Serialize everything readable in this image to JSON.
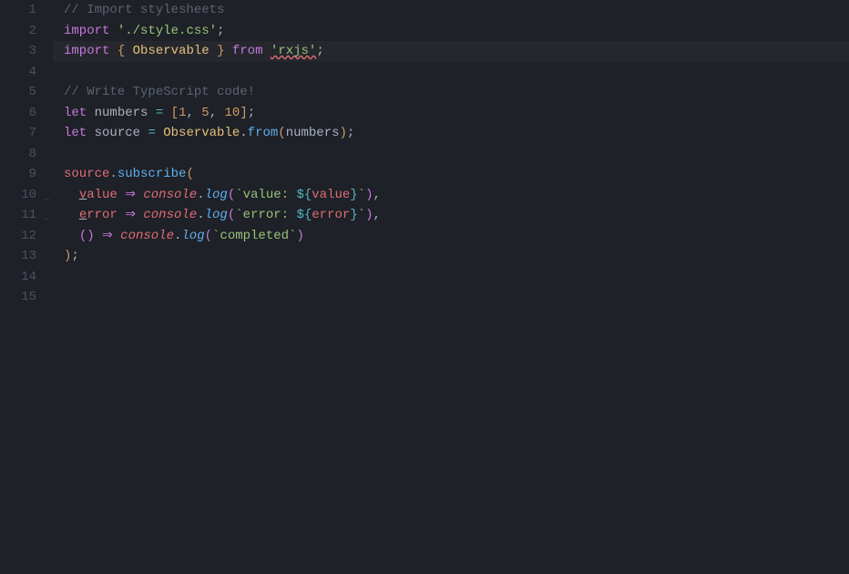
{
  "editor": {
    "language": "typescript",
    "currentLine": 3,
    "lineNumbers": [
      "1",
      "2",
      "3",
      "4",
      "5",
      "6",
      "7",
      "8",
      "9",
      "10",
      "11",
      "12",
      "13",
      "14",
      "15"
    ],
    "lines": [
      {
        "tokens": [
          {
            "t": "// Import stylesheets",
            "c": "cm"
          }
        ]
      },
      {
        "tokens": [
          {
            "t": "import",
            "c": "kw"
          },
          {
            "t": " ",
            "c": "pun"
          },
          {
            "t": "'./style.css'",
            "c": "str"
          },
          {
            "t": ";",
            "c": "pun"
          }
        ]
      },
      {
        "tokens": [
          {
            "t": "import",
            "c": "kw"
          },
          {
            "t": " ",
            "c": "pun"
          },
          {
            "t": "{",
            "c": "brkY"
          },
          {
            "t": " ",
            "c": "pun"
          },
          {
            "t": "Observable",
            "c": "cls"
          },
          {
            "t": " ",
            "c": "pun"
          },
          {
            "t": "}",
            "c": "brkY"
          },
          {
            "t": " ",
            "c": "pun"
          },
          {
            "t": "from",
            "c": "kw"
          },
          {
            "t": " ",
            "c": "pun"
          },
          {
            "t": "'rxjs'",
            "c": "err"
          },
          {
            "t": ";",
            "c": "pun"
          }
        ]
      },
      {
        "tokens": [
          {
            "t": "",
            "c": "pun"
          }
        ]
      },
      {
        "tokens": [
          {
            "t": "// Write TypeScript code!",
            "c": "cm"
          }
        ]
      },
      {
        "tokens": [
          {
            "t": "let",
            "c": "kw"
          },
          {
            "t": " numbers ",
            "c": "pun"
          },
          {
            "t": "=",
            "c": "op"
          },
          {
            "t": " ",
            "c": "pun"
          },
          {
            "t": "[",
            "c": "brkY"
          },
          {
            "t": "1",
            "c": "num"
          },
          {
            "t": ", ",
            "c": "pun"
          },
          {
            "t": "5",
            "c": "num"
          },
          {
            "t": ", ",
            "c": "pun"
          },
          {
            "t": "10",
            "c": "num"
          },
          {
            "t": "]",
            "c": "brkY"
          },
          {
            "t": ";",
            "c": "pun"
          }
        ]
      },
      {
        "tokens": [
          {
            "t": "let",
            "c": "kw"
          },
          {
            "t": " source ",
            "c": "pun"
          },
          {
            "t": "=",
            "c": "op"
          },
          {
            "t": " ",
            "c": "pun"
          },
          {
            "t": "Observable",
            "c": "cls"
          },
          {
            "t": ".",
            "c": "pun"
          },
          {
            "t": "from",
            "c": "fn"
          },
          {
            "t": "(",
            "c": "brkY"
          },
          {
            "t": "numbers",
            "c": "pun"
          },
          {
            "t": ")",
            "c": "brkY"
          },
          {
            "t": ";",
            "c": "pun"
          }
        ]
      },
      {
        "tokens": [
          {
            "t": "",
            "c": "pun"
          }
        ]
      },
      {
        "tokens": [
          {
            "t": "source",
            "c": "var"
          },
          {
            "t": ".",
            "c": "pun"
          },
          {
            "t": "subscribe",
            "c": "fn"
          },
          {
            "t": "(",
            "c": "brkY"
          }
        ]
      },
      {
        "fold": "…",
        "tokens": [
          {
            "t": "  ",
            "c": "pun"
          },
          {
            "t": "v",
            "c": "var udl"
          },
          {
            "t": "alue",
            "c": "var"
          },
          {
            "t": " ",
            "c": "pun"
          },
          {
            "t": "⇒",
            "c": "kw"
          },
          {
            "t": " ",
            "c": "pun"
          },
          {
            "t": "console",
            "c": "obj"
          },
          {
            "t": ".",
            "c": "pun"
          },
          {
            "t": "log",
            "c": "fnI"
          },
          {
            "t": "(",
            "c": "brk"
          },
          {
            "t": "`value: ",
            "c": "str"
          },
          {
            "t": "${",
            "c": "brkB"
          },
          {
            "t": "value",
            "c": "var"
          },
          {
            "t": "}",
            "c": "brkB"
          },
          {
            "t": "`",
            "c": "str"
          },
          {
            "t": ")",
            "c": "brk"
          },
          {
            "t": ",",
            "c": "pun"
          }
        ]
      },
      {
        "fold": "…",
        "tokens": [
          {
            "t": "  ",
            "c": "pun"
          },
          {
            "t": "e",
            "c": "var udl"
          },
          {
            "t": "rror",
            "c": "var"
          },
          {
            "t": " ",
            "c": "pun"
          },
          {
            "t": "⇒",
            "c": "kw"
          },
          {
            "t": " ",
            "c": "pun"
          },
          {
            "t": "console",
            "c": "obj"
          },
          {
            "t": ".",
            "c": "pun"
          },
          {
            "t": "log",
            "c": "fnI"
          },
          {
            "t": "(",
            "c": "brk"
          },
          {
            "t": "`error: ",
            "c": "str"
          },
          {
            "t": "${",
            "c": "brkB"
          },
          {
            "t": "error",
            "c": "var"
          },
          {
            "t": "}",
            "c": "brkB"
          },
          {
            "t": "`",
            "c": "str"
          },
          {
            "t": ")",
            "c": "brk"
          },
          {
            "t": ",",
            "c": "pun"
          }
        ]
      },
      {
        "tokens": [
          {
            "t": "  ",
            "c": "pun"
          },
          {
            "t": "(",
            "c": "brk"
          },
          {
            "t": ")",
            "c": "brk"
          },
          {
            "t": " ",
            "c": "pun"
          },
          {
            "t": "⇒",
            "c": "kw"
          },
          {
            "t": " ",
            "c": "pun"
          },
          {
            "t": "console",
            "c": "obj"
          },
          {
            "t": ".",
            "c": "pun"
          },
          {
            "t": "log",
            "c": "fnI"
          },
          {
            "t": "(",
            "c": "brk"
          },
          {
            "t": "`completed`",
            "c": "str"
          },
          {
            "t": ")",
            "c": "brk"
          }
        ]
      },
      {
        "tokens": [
          {
            "t": ")",
            "c": "brkY"
          },
          {
            "t": ";",
            "c": "pun"
          }
        ]
      },
      {
        "tokens": [
          {
            "t": "",
            "c": "pun"
          }
        ]
      },
      {
        "tokens": [
          {
            "t": "",
            "c": "pun"
          }
        ]
      }
    ]
  }
}
